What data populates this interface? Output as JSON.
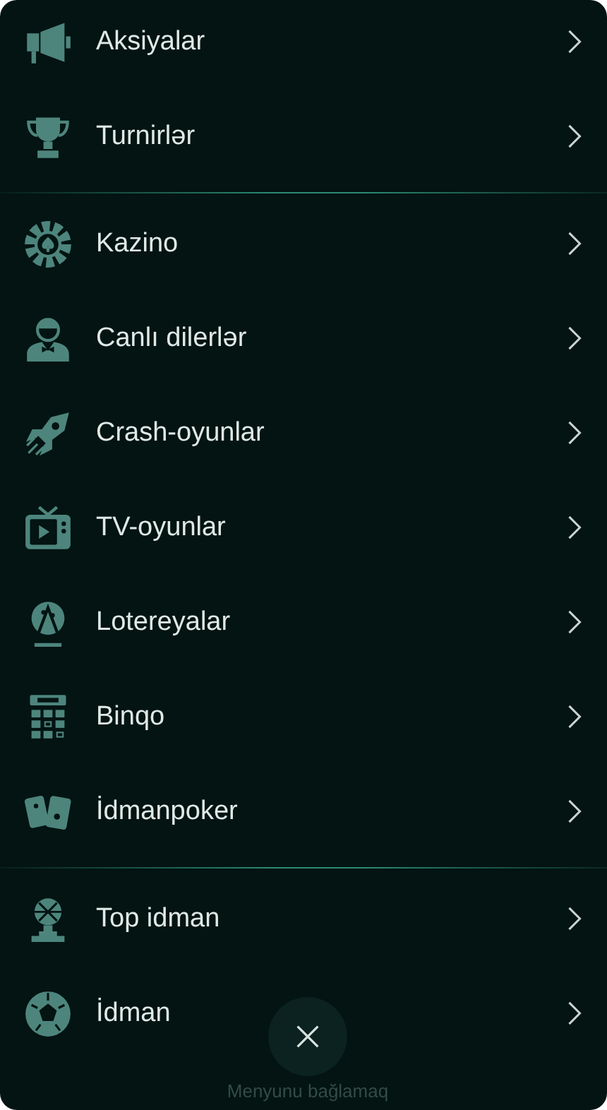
{
  "menu": {
    "groups": [
      {
        "items": [
          {
            "label": "Aksiyalar"
          },
          {
            "label": "Turnirlər"
          }
        ]
      },
      {
        "items": [
          {
            "label": "Kazino"
          },
          {
            "label": "Canlı dilerlər"
          },
          {
            "label": "Crash-oyunlar"
          },
          {
            "label": "TV-oyunlar"
          },
          {
            "label": "Lotereyalar"
          },
          {
            "label": "Binqo"
          },
          {
            "label": "İdmanpoker"
          }
        ]
      },
      {
        "items": [
          {
            "label": "Top idman"
          },
          {
            "label": "İdman"
          }
        ]
      }
    ]
  },
  "close": {
    "label": "Menyunu bağlamaq"
  }
}
